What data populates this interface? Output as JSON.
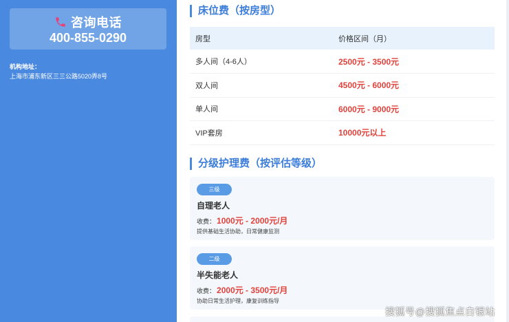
{
  "sidebar": {
    "phone_title": "咨询电话",
    "phone_number": "400-855-0290",
    "address_label": "机构地址：",
    "address_value": "上海市浦东新区三三公路5020弄8号"
  },
  "bed_section": {
    "title": "床位费（按房型）",
    "headers": [
      "房型",
      "价格区间（月）"
    ],
    "rows": [
      {
        "room": "多人间（4-6人）",
        "price": "2500元 - 3500元"
      },
      {
        "room": "双人间",
        "price": "4500元 - 6000元"
      },
      {
        "room": "单人间",
        "price": "6000元 - 9000元"
      },
      {
        "room": "VIP套房",
        "price": "10000元以上"
      }
    ]
  },
  "care_section": {
    "title": "分级护理费（按评估等级）",
    "fee_label": "收费：",
    "levels": [
      {
        "badge": "三级",
        "name": "自理老人",
        "fee": "1000元 - 2000元/月",
        "desc": "提供基础生活协助，日常健康监测"
      },
      {
        "badge": "二级",
        "name": "半失能老人",
        "fee": "2000元 - 3500元/月",
        "desc": "协助日常生活护理，康复训练指导"
      }
    ]
  },
  "watermark": "搜狐号@搜狐焦点白银站",
  "colors": {
    "sidebar_bg": "#4a89e0",
    "accent": "#3b7dd8",
    "price_red": "#e0423b",
    "phone_icon": "#e8417a"
  },
  "icons": {
    "phone": "phone-icon"
  }
}
